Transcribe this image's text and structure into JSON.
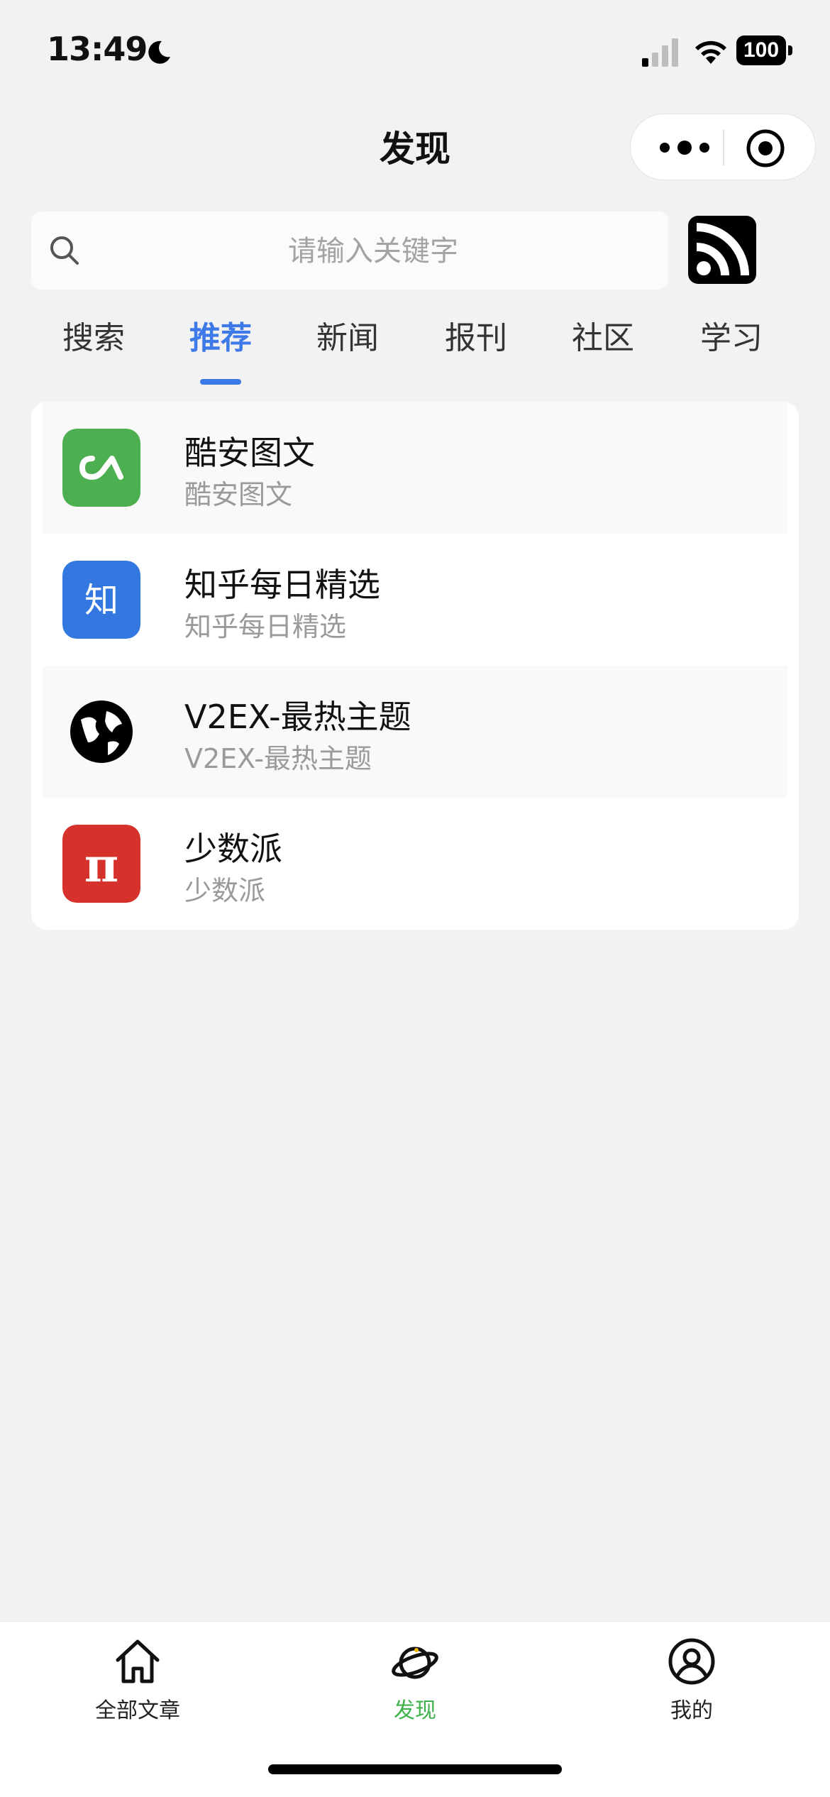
{
  "status_bar": {
    "time": "13:49",
    "battery": "100"
  },
  "nav": {
    "title": "发现"
  },
  "search": {
    "placeholder": "请输入关键字"
  },
  "tabs": [
    {
      "label": "搜索",
      "active": false
    },
    {
      "label": "推荐",
      "active": true
    },
    {
      "label": "新闻",
      "active": false
    },
    {
      "label": "报刊",
      "active": false
    },
    {
      "label": "社区",
      "active": false
    },
    {
      "label": "学习",
      "active": false
    }
  ],
  "feeds": [
    {
      "title": "酷安图文",
      "subtitle": "酷安图文",
      "icon": "coolapk-icon",
      "color": "#4caf50"
    },
    {
      "title": "知乎每日精选",
      "subtitle": "知乎每日精选",
      "icon": "zhihu-icon",
      "icon_text": "知",
      "color": "#3377e0"
    },
    {
      "title": "V2EX-最热主题",
      "subtitle": "V2EX-最热主题",
      "icon": "globe-icon",
      "color": "#000000"
    },
    {
      "title": "少数派",
      "subtitle": "少数派",
      "icon": "sspai-icon",
      "icon_text": "π",
      "color": "#d6312b"
    }
  ],
  "tab_bar": [
    {
      "label": "全部文章",
      "icon": "home-icon",
      "active": false
    },
    {
      "label": "发现",
      "icon": "planet-icon",
      "active": true
    },
    {
      "label": "我的",
      "icon": "user-icon",
      "active": false
    }
  ],
  "colors": {
    "accent": "#3e79e8",
    "active_tab": "#3fb24b"
  }
}
